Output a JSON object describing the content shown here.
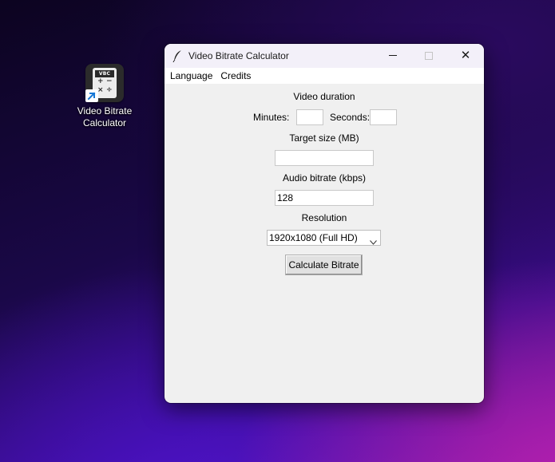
{
  "desktop": {
    "shortcut": {
      "icon_text": "VBC",
      "label_line1": "Video Bitrate",
      "label_line2": "Calculator",
      "keys": [
        "+",
        "−",
        "×",
        "÷"
      ]
    }
  },
  "window": {
    "title": "Video Bitrate Calculator",
    "icons": {
      "app": "feather-icon",
      "minimize": "minimize-icon",
      "maximize": "maximize-icon",
      "close": "close-icon"
    },
    "close_glyph": "✕"
  },
  "menubar": {
    "items": [
      "Language",
      "Credits"
    ]
  },
  "form": {
    "video_duration_label": "Video duration",
    "minutes_label": "Minutes:",
    "minutes_value": "",
    "seconds_label": "Seconds:",
    "seconds_value": "",
    "target_size_label": "Target size (MB)",
    "target_size_value": "",
    "audio_bitrate_label": "Audio bitrate (kbps)",
    "audio_bitrate_value": "128",
    "resolution_label": "Resolution",
    "resolution_selected": "1920x1080 (Full HD)",
    "calculate_button": "Calculate Bitrate"
  },
  "colors": {
    "window_bg": "#f0f0f0",
    "titlebar_bg": "#f3f0f9",
    "menubar_bg": "#ffffff",
    "shortcut_arrow": "#1778d6"
  }
}
